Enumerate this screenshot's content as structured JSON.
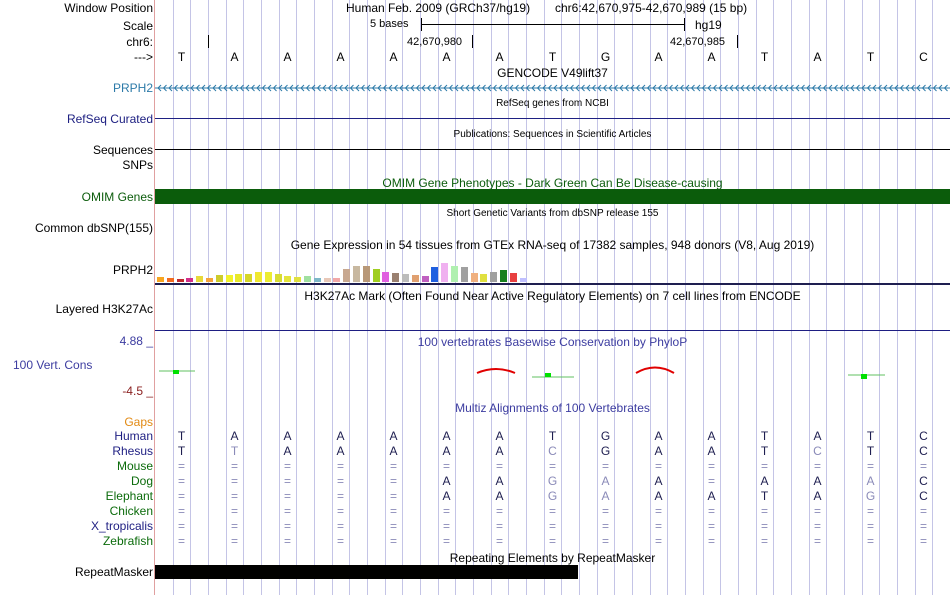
{
  "position": {
    "window_label": "Window Position",
    "assembly": "Human Feb. 2009 (GRCh37/hg19)",
    "region": "chr6:42,670,975-42,670,989 (15 bp)"
  },
  "scale": {
    "label": "Scale",
    "value": "5 bases",
    "db": "hg19"
  },
  "chrom": {
    "label": "chr6:",
    "tick1": "42,670,980",
    "tick2": "42,670,985"
  },
  "strand": {
    "label": "--->",
    "bases": [
      "T",
      "A",
      "A",
      "A",
      "A",
      "A",
      "A",
      "T",
      "G",
      "A",
      "A",
      "T",
      "A",
      "T",
      "C"
    ]
  },
  "tracks": {
    "gencode": {
      "title": "GENCODE V49lift37",
      "gene": "PRPH2",
      "color": "#2c7aa8"
    },
    "refseq": {
      "label": "RefSeq Curated",
      "title": "RefSeq genes from NCBI",
      "color": "#1e2082"
    },
    "publications": {
      "label1": "Sequences",
      "title": "Publications: Sequences in Scientific Articles"
    },
    "snps": {
      "label": "SNPs"
    },
    "omim": {
      "label": "OMIM Genes",
      "title": "OMIM Gene Phenotypes - Dark Green Can Be Disease-causing",
      "color": "#0b5c0b"
    },
    "dbsnp": {
      "label": "Common dbSNP(155)",
      "title": "Short Genetic Variants from dbSNP release 155"
    },
    "gtex": {
      "label": "PRPH2",
      "title": "Gene Expression in 54 tissues from GTEx RNA-seq of 17382 samples, 948 donors (V8, Aug 2019)"
    },
    "h3k27ac": {
      "label": "Layered H3K27Ac",
      "title": "H3K27Ac Mark (Often Found Near Active Regulatory Elements) on 7 cell lines from ENCODE"
    },
    "cons": {
      "label": "100 Vert. Cons",
      "max": "4.88 _",
      "min": "-4.5 _",
      "title": "100 vertebrates Basewise Conservation by PhyloP",
      "color": "#3c3ca0"
    },
    "multiz": {
      "gaps": "Gaps",
      "title": "Multiz Alignments of 100 Vertebrates",
      "gaps_color": "#e28a14"
    },
    "repeatmasker": {
      "label": "RepeatMasker",
      "title": "Repeating Elements by RepeatMasker"
    }
  },
  "gtex_colors": [
    "#f7a521",
    "#f26b22",
    "#c02a2e",
    "#d32f8a",
    "#e7d93a",
    "#f5a33a",
    "#cdcc2b",
    "#f2f22b",
    "#e8e82a",
    "#d6d628",
    "#f0e830",
    "#ecec32",
    "#d8dc34",
    "#e4e43c",
    "#e0e040",
    "#a0e0a0",
    "#7db7c8",
    "#e8c8b8",
    "#f2a8a8",
    "#c8a890",
    "#c8b8a0",
    "#b89878",
    "#a0ce20",
    "#e060e0",
    "#9a8070",
    "#bcbcbc",
    "#e0a070",
    "#c060c0",
    "#2060e0",
    "#f0b0f0",
    "#b0f0b0",
    "#a0a0a0",
    "#f0b080",
    "#e0e040",
    "#a0a0a0",
    "#188020",
    "#e84040",
    "#c0c0ff"
  ],
  "gtex_heights": [
    0.17,
    0.12,
    0.1,
    0.15,
    0.2,
    0.14,
    0.25,
    0.22,
    0.28,
    0.27,
    0.32,
    0.34,
    0.26,
    0.2,
    0.18,
    0.19,
    0.14,
    0.12,
    0.15,
    0.45,
    0.53,
    0.52,
    0.42,
    0.35,
    0.3,
    0.27,
    0.23,
    0.2,
    0.5,
    0.62,
    0.55,
    0.5,
    0.3,
    0.27,
    0.35,
    0.4,
    0.3,
    0.12
  ],
  "alignments": [
    {
      "species": "Human",
      "color": "#1e1e82",
      "bases": [
        "T",
        "A",
        "A",
        "A",
        "A",
        "A",
        "A",
        "T",
        "G",
        "A",
        "A",
        "T",
        "A",
        "T",
        "C"
      ],
      "faint": []
    },
    {
      "species": "Rhesus",
      "color": "#1e1e82",
      "bases": [
        "T",
        "T",
        "A",
        "A",
        "A",
        "A",
        "A",
        "C",
        "G",
        "A",
        "A",
        "T",
        "C",
        "T",
        "C"
      ],
      "faint": [
        1,
        7,
        12
      ]
    },
    {
      "species": "Mouse",
      "color": "#0b6b0b",
      "bases": [
        "=",
        "=",
        "=",
        "=",
        "=",
        "=",
        "=",
        "=",
        "=",
        "=",
        "=",
        "=",
        "=",
        "=",
        "="
      ],
      "faint": [
        0,
        1,
        2,
        3,
        4,
        5,
        6,
        7,
        8,
        9,
        10,
        11,
        12,
        13,
        14
      ]
    },
    {
      "species": "Dog",
      "color": "#0b6b0b",
      "bases": [
        "=",
        "=",
        "=",
        "=",
        "=",
        "A",
        "A",
        "G",
        "A",
        "A",
        "=",
        "A",
        "A",
        "A",
        "C"
      ],
      "faint": [
        0,
        1,
        2,
        3,
        4,
        7,
        8,
        10,
        13
      ]
    },
    {
      "species": "Elephant",
      "color": "#0b6b0b",
      "bases": [
        "=",
        "=",
        "=",
        "=",
        "=",
        "A",
        "A",
        "G",
        "A",
        "A",
        "A",
        "T",
        "A",
        "G",
        "C"
      ],
      "faint": [
        0,
        1,
        2,
        3,
        4,
        7,
        8,
        13
      ]
    },
    {
      "species": "Chicken",
      "color": "#0b6b0b",
      "bases": [
        "=",
        "=",
        "=",
        "=",
        "=",
        "=",
        "=",
        "=",
        "=",
        "=",
        "=",
        "=",
        "=",
        "=",
        "="
      ],
      "faint": [
        0,
        1,
        2,
        3,
        4,
        5,
        6,
        7,
        8,
        9,
        10,
        11,
        12,
        13,
        14
      ]
    },
    {
      "species": "X_tropicalis",
      "color": "#1e1e82",
      "bases": [
        "=",
        "=",
        "=",
        "=",
        "=",
        "=",
        "=",
        "=",
        "=",
        "=",
        "=",
        "=",
        "=",
        "=",
        "="
      ],
      "faint": [
        0,
        1,
        2,
        3,
        4,
        5,
        6,
        7,
        8,
        9,
        10,
        11,
        12,
        13,
        14
      ]
    },
    {
      "species": "Zebrafish",
      "color": "#0b6b0b",
      "bases": [
        "=",
        "=",
        "=",
        "=",
        "=",
        "=",
        "=",
        "=",
        "=",
        "=",
        "=",
        "=",
        "=",
        "=",
        "="
      ],
      "faint": [
        0,
        1,
        2,
        3,
        4,
        5,
        6,
        7,
        8,
        9,
        10,
        11,
        12,
        13,
        14
      ]
    }
  ]
}
